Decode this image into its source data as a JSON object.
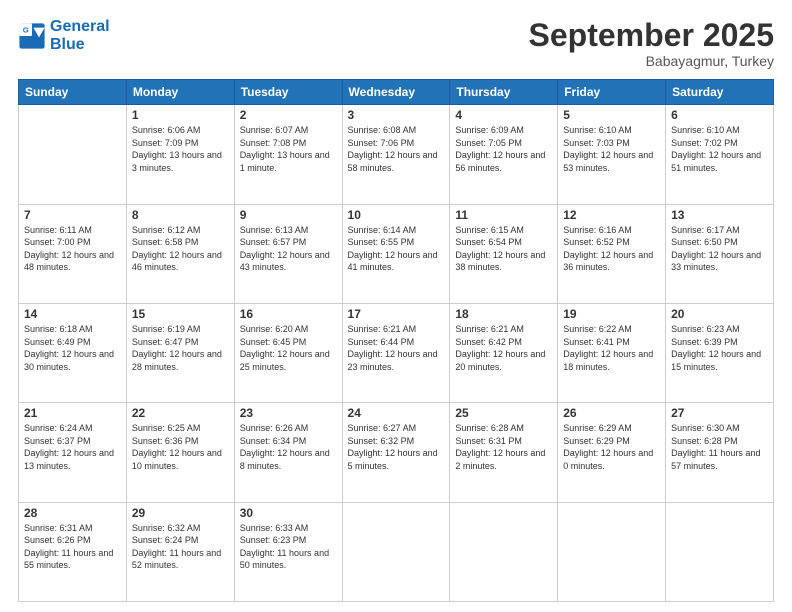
{
  "logo": {
    "line1": "General",
    "line2": "Blue"
  },
  "title": "September 2025",
  "subtitle": "Babayagmur, Turkey",
  "days_header": [
    "Sunday",
    "Monday",
    "Tuesday",
    "Wednesday",
    "Thursday",
    "Friday",
    "Saturday"
  ],
  "weeks": [
    [
      {
        "day": "",
        "sunrise": "",
        "sunset": "",
        "daylight": ""
      },
      {
        "day": "1",
        "sunrise": "Sunrise: 6:06 AM",
        "sunset": "Sunset: 7:09 PM",
        "daylight": "Daylight: 13 hours and 3 minutes."
      },
      {
        "day": "2",
        "sunrise": "Sunrise: 6:07 AM",
        "sunset": "Sunset: 7:08 PM",
        "daylight": "Daylight: 13 hours and 1 minute."
      },
      {
        "day": "3",
        "sunrise": "Sunrise: 6:08 AM",
        "sunset": "Sunset: 7:06 PM",
        "daylight": "Daylight: 12 hours and 58 minutes."
      },
      {
        "day": "4",
        "sunrise": "Sunrise: 6:09 AM",
        "sunset": "Sunset: 7:05 PM",
        "daylight": "Daylight: 12 hours and 56 minutes."
      },
      {
        "day": "5",
        "sunrise": "Sunrise: 6:10 AM",
        "sunset": "Sunset: 7:03 PM",
        "daylight": "Daylight: 12 hours and 53 minutes."
      },
      {
        "day": "6",
        "sunrise": "Sunrise: 6:10 AM",
        "sunset": "Sunset: 7:02 PM",
        "daylight": "Daylight: 12 hours and 51 minutes."
      }
    ],
    [
      {
        "day": "7",
        "sunrise": "Sunrise: 6:11 AM",
        "sunset": "Sunset: 7:00 PM",
        "daylight": "Daylight: 12 hours and 48 minutes."
      },
      {
        "day": "8",
        "sunrise": "Sunrise: 6:12 AM",
        "sunset": "Sunset: 6:58 PM",
        "daylight": "Daylight: 12 hours and 46 minutes."
      },
      {
        "day": "9",
        "sunrise": "Sunrise: 6:13 AM",
        "sunset": "Sunset: 6:57 PM",
        "daylight": "Daylight: 12 hours and 43 minutes."
      },
      {
        "day": "10",
        "sunrise": "Sunrise: 6:14 AM",
        "sunset": "Sunset: 6:55 PM",
        "daylight": "Daylight: 12 hours and 41 minutes."
      },
      {
        "day": "11",
        "sunrise": "Sunrise: 6:15 AM",
        "sunset": "Sunset: 6:54 PM",
        "daylight": "Daylight: 12 hours and 38 minutes."
      },
      {
        "day": "12",
        "sunrise": "Sunrise: 6:16 AM",
        "sunset": "Sunset: 6:52 PM",
        "daylight": "Daylight: 12 hours and 36 minutes."
      },
      {
        "day": "13",
        "sunrise": "Sunrise: 6:17 AM",
        "sunset": "Sunset: 6:50 PM",
        "daylight": "Daylight: 12 hours and 33 minutes."
      }
    ],
    [
      {
        "day": "14",
        "sunrise": "Sunrise: 6:18 AM",
        "sunset": "Sunset: 6:49 PM",
        "daylight": "Daylight: 12 hours and 30 minutes."
      },
      {
        "day": "15",
        "sunrise": "Sunrise: 6:19 AM",
        "sunset": "Sunset: 6:47 PM",
        "daylight": "Daylight: 12 hours and 28 minutes."
      },
      {
        "day": "16",
        "sunrise": "Sunrise: 6:20 AM",
        "sunset": "Sunset: 6:45 PM",
        "daylight": "Daylight: 12 hours and 25 minutes."
      },
      {
        "day": "17",
        "sunrise": "Sunrise: 6:21 AM",
        "sunset": "Sunset: 6:44 PM",
        "daylight": "Daylight: 12 hours and 23 minutes."
      },
      {
        "day": "18",
        "sunrise": "Sunrise: 6:21 AM",
        "sunset": "Sunset: 6:42 PM",
        "daylight": "Daylight: 12 hours and 20 minutes."
      },
      {
        "day": "19",
        "sunrise": "Sunrise: 6:22 AM",
        "sunset": "Sunset: 6:41 PM",
        "daylight": "Daylight: 12 hours and 18 minutes."
      },
      {
        "day": "20",
        "sunrise": "Sunrise: 6:23 AM",
        "sunset": "Sunset: 6:39 PM",
        "daylight": "Daylight: 12 hours and 15 minutes."
      }
    ],
    [
      {
        "day": "21",
        "sunrise": "Sunrise: 6:24 AM",
        "sunset": "Sunset: 6:37 PM",
        "daylight": "Daylight: 12 hours and 13 minutes."
      },
      {
        "day": "22",
        "sunrise": "Sunrise: 6:25 AM",
        "sunset": "Sunset: 6:36 PM",
        "daylight": "Daylight: 12 hours and 10 minutes."
      },
      {
        "day": "23",
        "sunrise": "Sunrise: 6:26 AM",
        "sunset": "Sunset: 6:34 PM",
        "daylight": "Daylight: 12 hours and 8 minutes."
      },
      {
        "day": "24",
        "sunrise": "Sunrise: 6:27 AM",
        "sunset": "Sunset: 6:32 PM",
        "daylight": "Daylight: 12 hours and 5 minutes."
      },
      {
        "day": "25",
        "sunrise": "Sunrise: 6:28 AM",
        "sunset": "Sunset: 6:31 PM",
        "daylight": "Daylight: 12 hours and 2 minutes."
      },
      {
        "day": "26",
        "sunrise": "Sunrise: 6:29 AM",
        "sunset": "Sunset: 6:29 PM",
        "daylight": "Daylight: 12 hours and 0 minutes."
      },
      {
        "day": "27",
        "sunrise": "Sunrise: 6:30 AM",
        "sunset": "Sunset: 6:28 PM",
        "daylight": "Daylight: 11 hours and 57 minutes."
      }
    ],
    [
      {
        "day": "28",
        "sunrise": "Sunrise: 6:31 AM",
        "sunset": "Sunset: 6:26 PM",
        "daylight": "Daylight: 11 hours and 55 minutes."
      },
      {
        "day": "29",
        "sunrise": "Sunrise: 6:32 AM",
        "sunset": "Sunset: 6:24 PM",
        "daylight": "Daylight: 11 hours and 52 minutes."
      },
      {
        "day": "30",
        "sunrise": "Sunrise: 6:33 AM",
        "sunset": "Sunset: 6:23 PM",
        "daylight": "Daylight: 11 hours and 50 minutes."
      },
      {
        "day": "",
        "sunrise": "",
        "sunset": "",
        "daylight": ""
      },
      {
        "day": "",
        "sunrise": "",
        "sunset": "",
        "daylight": ""
      },
      {
        "day": "",
        "sunrise": "",
        "sunset": "",
        "daylight": ""
      },
      {
        "day": "",
        "sunrise": "",
        "sunset": "",
        "daylight": ""
      }
    ]
  ]
}
